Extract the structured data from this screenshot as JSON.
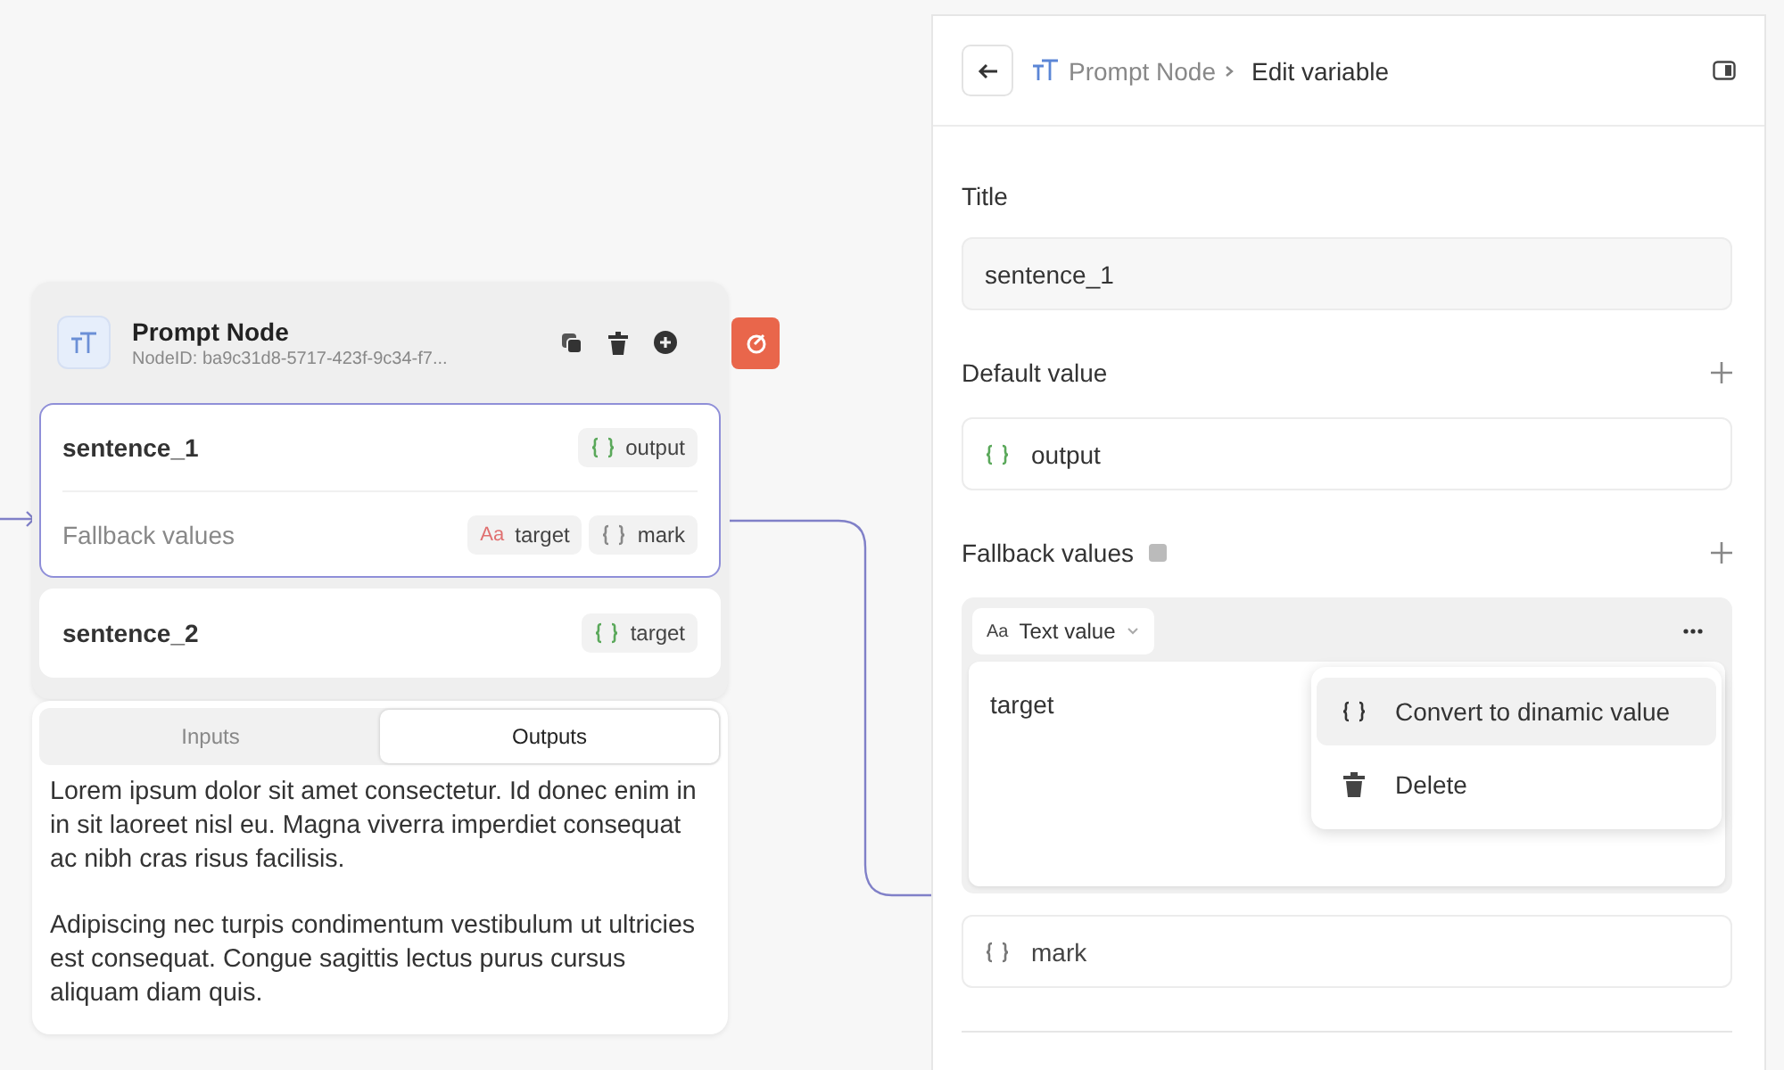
{
  "node": {
    "title": "Prompt Node",
    "node_id": "NodeID: ba9c31d8-5717-423f-9c34-f7...",
    "variables": [
      {
        "name": "sentence_1",
        "selected": true,
        "default": {
          "kind": "dynamic",
          "label": "output"
        },
        "fallback_label": "Fallback values",
        "fallbacks": [
          {
            "kind": "text",
            "icon": "Aa",
            "label": "target"
          },
          {
            "kind": "dynamic",
            "label": "mark"
          }
        ]
      },
      {
        "name": "sentence_2",
        "selected": false,
        "default": {
          "kind": "dynamic",
          "label": "target"
        }
      }
    ]
  },
  "io_panel": {
    "tabs": [
      {
        "label": "Inputs",
        "selected": false
      },
      {
        "label": "Outputs",
        "selected": true
      }
    ],
    "paragraphs": [
      "Lorem ipsum dolor sit amet consectetur. Id donec enim in in sit laoreet nisl eu. Magna viverra imperdiet consequat ac nibh cras risus facilisis.",
      "Adipiscing nec turpis condimentum vestibulum ut ultricies est consequat. Congue sagittis lectus purus cursus aliquam diam quis."
    ]
  },
  "editor": {
    "breadcrumb": {
      "parent": "Prompt Node",
      "current": "Edit variable"
    },
    "title_label": "Title",
    "title_value": "sentence_1",
    "default_label": "Default value",
    "default_value": {
      "kind": "dynamic",
      "label": "output"
    },
    "fallback_label": "Fallback values",
    "fallbacks": [
      {
        "kind": "text",
        "icon": "Aa",
        "type_label": "Text value",
        "value": "target"
      },
      {
        "kind": "dynamic",
        "label": "mark"
      }
    ],
    "menu": [
      {
        "kind": "convert",
        "label": "Convert to dinamic value",
        "selected": true
      },
      {
        "kind": "delete",
        "label": "Delete",
        "selected": false
      }
    ]
  }
}
